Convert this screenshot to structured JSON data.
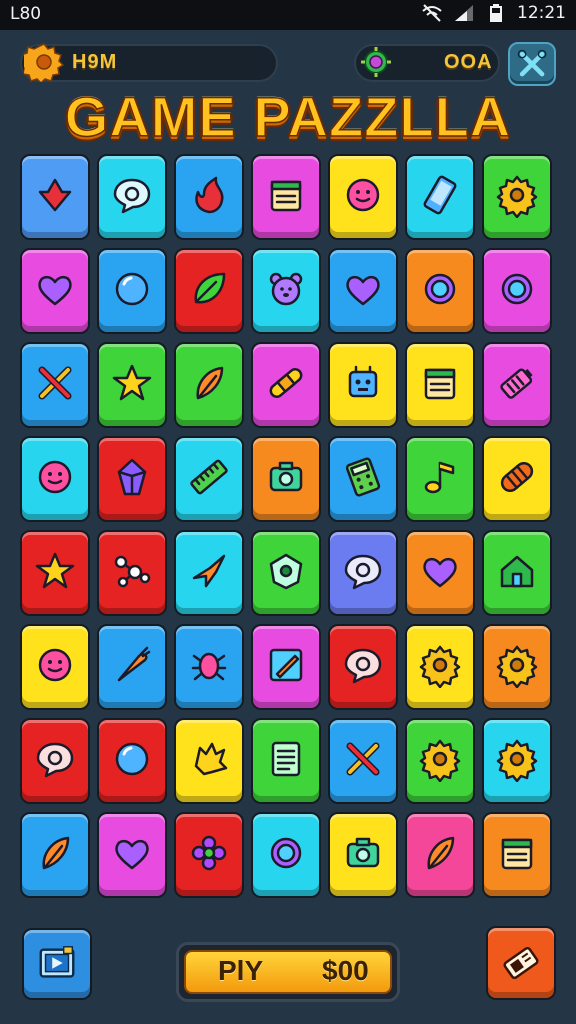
{
  "status_bar": {
    "left_text": "L80",
    "time": "12:21"
  },
  "hud": {
    "left_value": "H9M",
    "right_value": "OOA"
  },
  "title": "GAME PAZZLLA",
  "play_button": {
    "label": "PlY",
    "cost": "$00"
  },
  "grid": {
    "rows": [
      [
        [
          "c-sky",
          "arrow-down-icon"
        ],
        [
          "c-cyan",
          "speech-bubble-icon"
        ],
        [
          "c-blue",
          "flame-icon"
        ],
        [
          "c-magenta",
          "calendar-icon"
        ],
        [
          "c-yellow",
          "smiley-icon"
        ],
        [
          "c-cyan",
          "phone-icon"
        ],
        [
          "c-green",
          "gear-icon"
        ]
      ],
      [
        [
          "c-magenta",
          "heart-icon"
        ],
        [
          "c-blue",
          "bubble-icon"
        ],
        [
          "c-red",
          "leaf-icon"
        ],
        [
          "c-cyan",
          "bear-icon"
        ],
        [
          "c-blue",
          "heart-icon"
        ],
        [
          "c-orange",
          "ring-icon"
        ],
        [
          "c-magenta",
          "ring-icon"
        ]
      ],
      [
        [
          "c-blue",
          "crossed-swords-icon"
        ],
        [
          "c-green",
          "star-icon"
        ],
        [
          "c-green",
          "feather-icon"
        ],
        [
          "c-magenta",
          "bandage-icon"
        ],
        [
          "c-yellow",
          "robot-icon"
        ],
        [
          "c-yellow",
          "calendar-icon"
        ],
        [
          "c-magenta",
          "battery-icon"
        ]
      ],
      [
        [
          "c-cyan",
          "smiley-icon"
        ],
        [
          "c-red",
          "crystal-icon"
        ],
        [
          "c-cyan",
          "ruler-icon"
        ],
        [
          "c-orange",
          "camera-icon"
        ],
        [
          "c-blue",
          "calculator-icon"
        ],
        [
          "c-green",
          "music-note-icon"
        ],
        [
          "c-yellow",
          "capsule-icon"
        ]
      ],
      [
        [
          "c-red",
          "star-icon"
        ],
        [
          "c-red",
          "molecule-icon"
        ],
        [
          "c-cyan",
          "plane-icon"
        ],
        [
          "c-green",
          "badge-icon"
        ],
        [
          "c-indigo",
          "speech-bubble-icon"
        ],
        [
          "c-orange",
          "heart-icon"
        ],
        [
          "c-green",
          "home-icon"
        ]
      ],
      [
        [
          "c-yellow",
          "smiley-icon"
        ],
        [
          "c-blue",
          "carrot-icon"
        ],
        [
          "c-blue",
          "bug-icon"
        ],
        [
          "c-magenta",
          "pencil-icon"
        ],
        [
          "c-red",
          "speech-bubble-icon"
        ],
        [
          "c-yellow",
          "gear-icon"
        ],
        [
          "c-orange",
          "gear-icon"
        ]
      ],
      [
        [
          "c-red",
          "speech-bubble-icon"
        ],
        [
          "c-red",
          "bubble-icon"
        ],
        [
          "c-yellow",
          "splash-icon"
        ],
        [
          "c-green",
          "document-icon"
        ],
        [
          "c-blue",
          "crossed-swords-icon"
        ],
        [
          "c-green",
          "gear-icon"
        ],
        [
          "c-cyan",
          "gear-icon"
        ]
      ],
      [
        [
          "c-blue",
          "feather-icon"
        ],
        [
          "c-magenta",
          "heart-icon"
        ],
        [
          "c-red",
          "flower-icon"
        ],
        [
          "c-cyan",
          "ring-icon"
        ],
        [
          "c-yellow",
          "camera-icon"
        ],
        [
          "c-pink",
          "feather-icon"
        ],
        [
          "c-orange",
          "calendar-icon"
        ]
      ]
    ]
  },
  "colors": {
    "background": "#243545",
    "title_gold": "#ffc21f",
    "hud_gold": "#f4c53a"
  }
}
